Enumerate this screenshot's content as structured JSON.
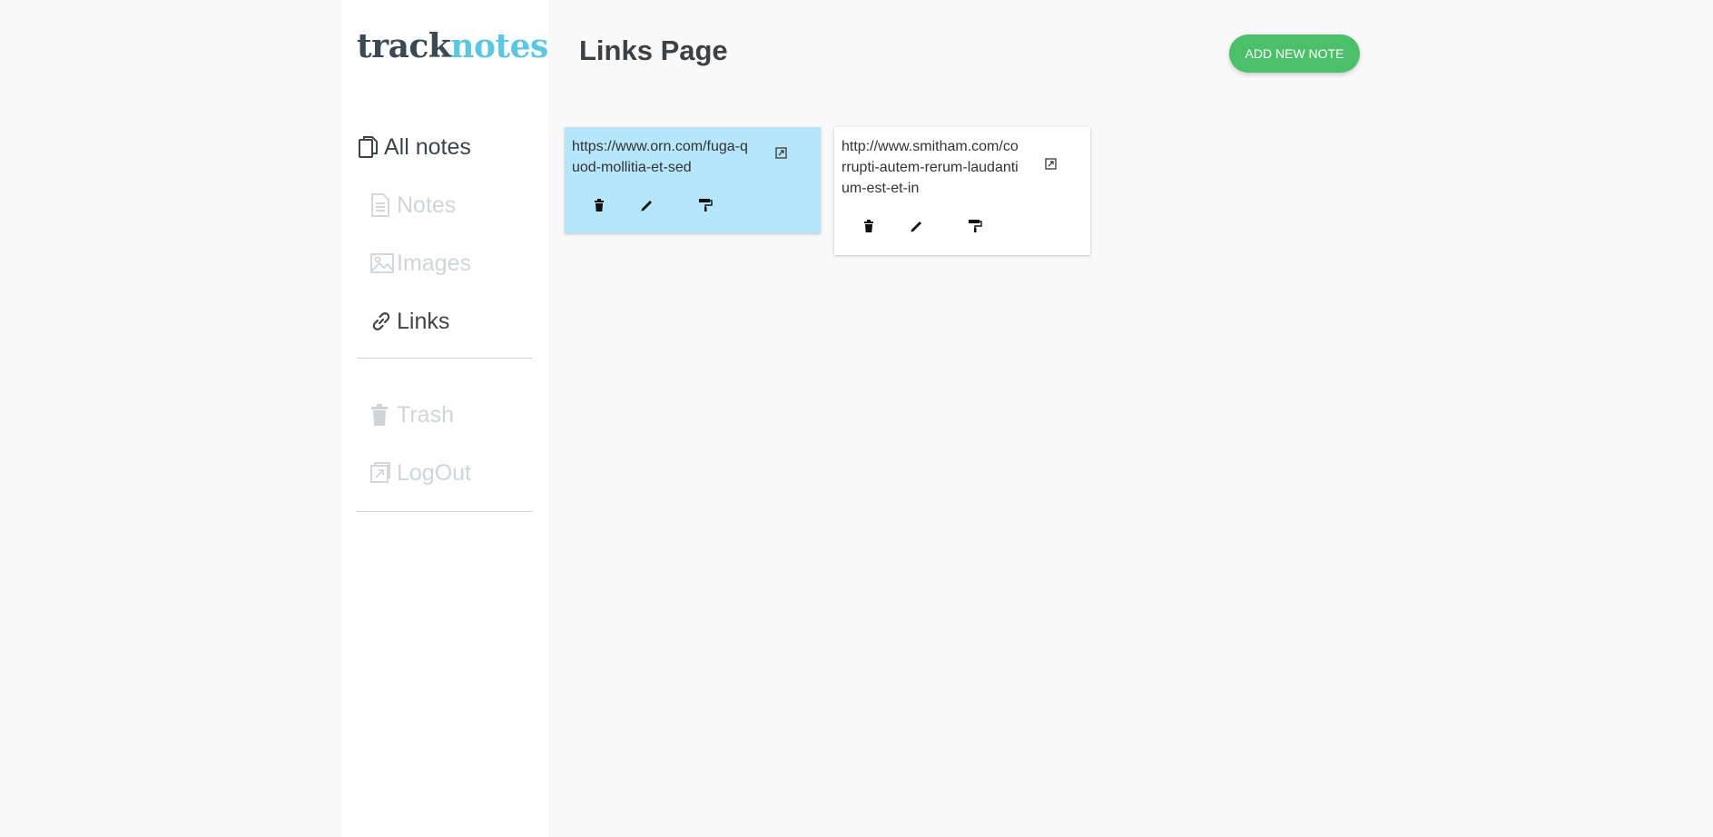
{
  "app": {
    "logo_part1": "track",
    "logo_part2": "notes"
  },
  "nav": {
    "all_notes": "All notes",
    "notes": "Notes",
    "images": "Images",
    "links": "Links",
    "trash": "Trash",
    "logout": "LogOut"
  },
  "page": {
    "title": "Links Page",
    "add_button": "ADD NEW NOTE"
  },
  "cards": [
    {
      "url": "https://www.orn.com/fuga-quod-mollitia-et-sed",
      "color": "#b5e6fb"
    },
    {
      "url": "http://www.smitham.com/corrupti-autem-rerum-laudantium-est-et-in",
      "color": "#ffffff"
    }
  ],
  "colors": {
    "accent_green": "#4cbf6b",
    "logo_blue": "#5bc7e0",
    "logo_dark": "#3a4a55"
  }
}
